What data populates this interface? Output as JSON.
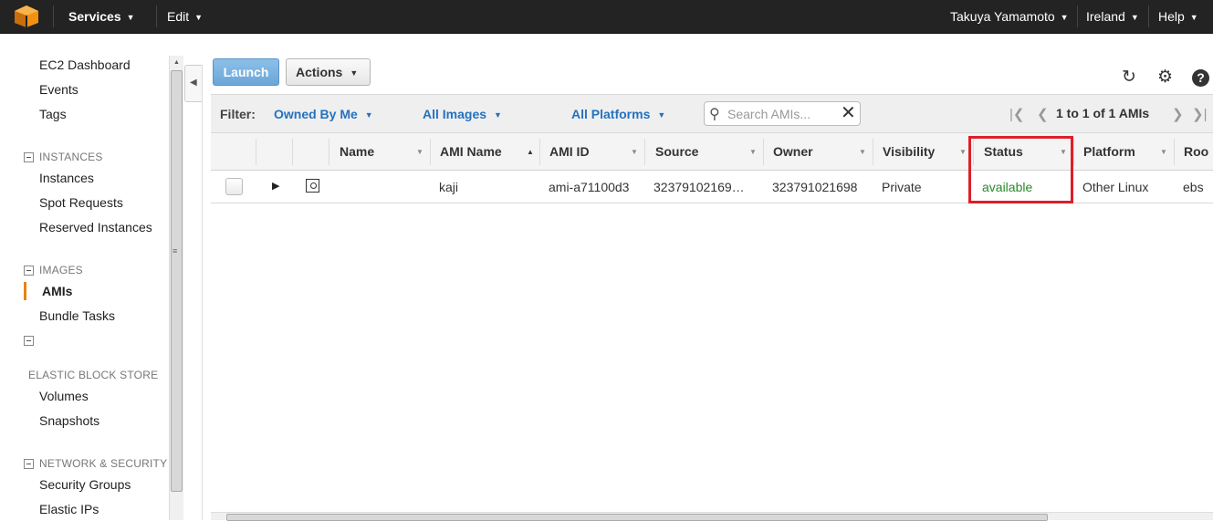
{
  "topbar": {
    "services": "Services",
    "edit": "Edit",
    "user": "Takuya Yamamoto",
    "region": "Ireland",
    "help": "Help"
  },
  "sidebar": {
    "top_links": [
      "EC2 Dashboard",
      "Events",
      "Tags"
    ],
    "instances": {
      "heading": "INSTANCES",
      "links": [
        "Instances",
        "Spot Requests",
        "Reserved Instances"
      ]
    },
    "images": {
      "heading": "IMAGES",
      "links": [
        "AMIs",
        "Bundle Tasks"
      ],
      "active": "AMIs"
    },
    "ebs": {
      "heading": "ELASTIC BLOCK STORE",
      "links": [
        "Volumes",
        "Snapshots"
      ]
    },
    "network": {
      "heading": "NETWORK & SECURITY",
      "links": [
        "Security Groups",
        "Elastic IPs"
      ]
    }
  },
  "toolbar": {
    "launch": "Launch",
    "actions": "Actions"
  },
  "filter": {
    "label": "Filter:",
    "owner": "Owned By Me",
    "images": "All Images",
    "platforms": "All Platforms",
    "search_placeholder": "Search AMIs...",
    "pager": "1 to 1 of 1 AMIs"
  },
  "table": {
    "columns": [
      "Name",
      "AMI Name",
      "AMI ID",
      "Source",
      "Owner",
      "Visibility",
      "Status",
      "Platform",
      "Roo"
    ],
    "rows": [
      {
        "name": "",
        "ami_name": "kaji",
        "ami_id": "ami-a71100d3",
        "source": "32379102169…",
        "owner": "323791021698",
        "visibility": "Private",
        "status": "available",
        "platform": "Other Linux",
        "root": "ebs"
      }
    ]
  },
  "colors": {
    "accent": "#e8831a",
    "link": "#2472c0",
    "status_ok": "#2a8a2a",
    "highlight": "#dd1f2a"
  }
}
